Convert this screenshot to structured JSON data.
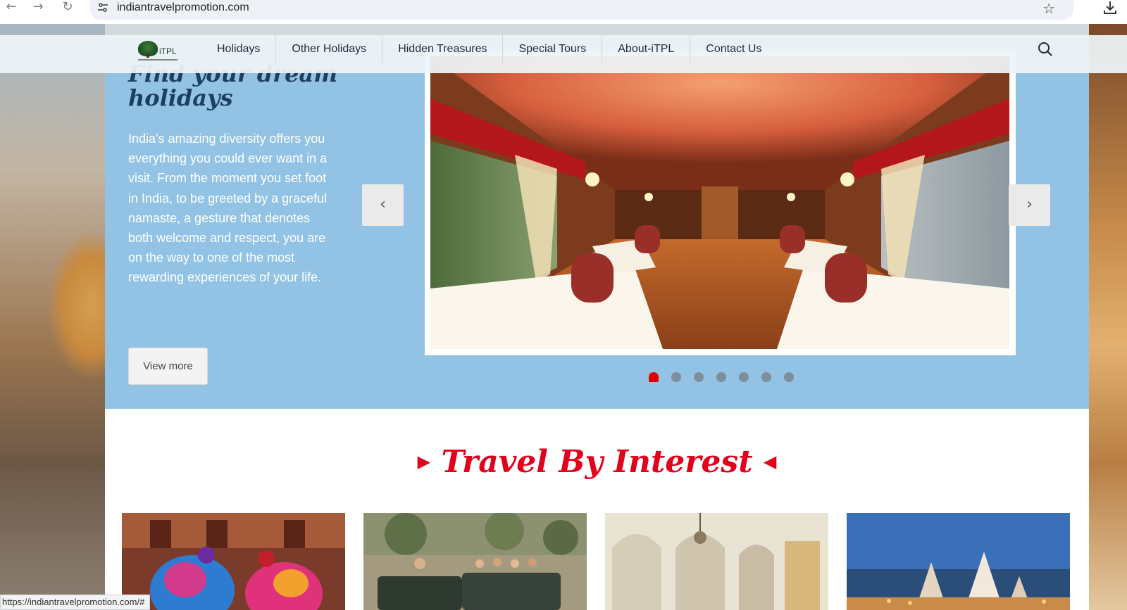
{
  "browser": {
    "url": "indiantravelpromotion.com",
    "status_url": "https://indiantravelpromotion.com/#",
    "icons": {
      "back": "back-arrow-icon",
      "forward": "forward-arrow-icon",
      "reload": "reload-icon",
      "site_info": "site-settings-icon",
      "bookmark": "star-icon",
      "download": "download-icon"
    }
  },
  "header": {
    "logo_text": "iTPL",
    "menu": [
      {
        "label": "Holidays"
      },
      {
        "label": "Other Holidays"
      },
      {
        "label": "Hidden Treasures"
      },
      {
        "label": "Special Tours"
      },
      {
        "label": "About-iTPL"
      },
      {
        "label": "Contact Us"
      }
    ]
  },
  "hero": {
    "title": "Find your dream holidays",
    "text": "India's amazing diversity offers you everything you could ever want in a visit. From the moment you set foot in India, to be  greeted by a graceful namaste, a gesture that denotes both welcome and respect, you are on the way to one of the most rewarding experiences of your life.",
    "view_more_label": "View more",
    "prev_arrow": "‹",
    "next_arrow": "›",
    "slides_count": 7,
    "active_slide": 1
  },
  "travel_by_interest": {
    "title": "Travel By Interest",
    "left_marker": "▶",
    "right_marker": "◀"
  },
  "colors": {
    "hero_bg": "#92c3e4",
    "title_red": "#e3001b",
    "active_dot": "#e00000"
  }
}
